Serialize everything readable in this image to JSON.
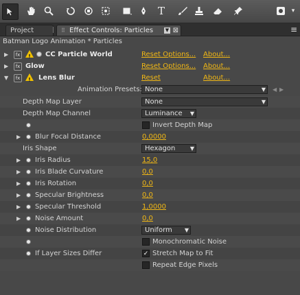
{
  "toolbar": {
    "tools": [
      "selection-tool",
      "hand-tool",
      "zoom-tool",
      "rotate-tool",
      "orbit-camera-tool",
      "pan-behind-tool",
      "rectangle-tool",
      "pen-tool",
      "text-tool",
      "brush-tool",
      "clone-stamp-tool",
      "eraser-tool",
      "puppet-pin-tool",
      "workspace-menu"
    ]
  },
  "tabs": {
    "project": "Project",
    "effect_controls": "Effect Controls: Particles"
  },
  "panel_header": "Batman Logo Animation * Particles",
  "effects": [
    {
      "name": "CC Particle World",
      "reset": "Reset Options...",
      "about": "About...",
      "warning": true,
      "expanded": false
    },
    {
      "name": "Glow",
      "reset": "Reset Options...",
      "about": "About...",
      "warning": false,
      "expanded": false
    },
    {
      "name": "Lens Blur",
      "reset": "Reset",
      "about": "About...",
      "warning": true,
      "expanded": true
    }
  ],
  "animation_presets": {
    "label": "Animation Presets:",
    "value": "None"
  },
  "properties": {
    "depth_map_layer": {
      "label": "Depth Map Layer",
      "value": "None"
    },
    "depth_map_channel": {
      "label": "Depth Map Channel",
      "value": "Luminance"
    },
    "invert_depth_map": {
      "label": "Invert Depth Map",
      "checked": false
    },
    "blur_focal_distance": {
      "label": "Blur Focal Distance",
      "value": "0,0000"
    },
    "iris_shape": {
      "label": "Iris Shape",
      "value": "Hexagon"
    },
    "iris_radius": {
      "label": "Iris Radius",
      "value": "15,0"
    },
    "iris_blade_curvature": {
      "label": "Iris Blade Curvature",
      "value": "0,0"
    },
    "iris_rotation": {
      "label": "Iris Rotation",
      "value": "0,0"
    },
    "specular_brightness": {
      "label": "Specular Brightness",
      "value": "0,0"
    },
    "specular_threshold": {
      "label": "Specular Threshold",
      "value": "1,0000"
    },
    "noise_amount": {
      "label": "Noise Amount",
      "value": "0,0"
    },
    "noise_distribution": {
      "label": "Noise Distribution",
      "value": "Uniform"
    },
    "monochromatic_noise": {
      "label": "Monochromatic Noise",
      "checked": false
    },
    "if_layer_sizes_differ": {
      "label": "If Layer Sizes Differ"
    },
    "stretch_map_to_fit": {
      "label": "Stretch Map to Fit",
      "checked": true
    },
    "repeat_edge_pixels": {
      "label": "Repeat Edge Pixels",
      "checked": false
    }
  },
  "colors": {
    "accent": "#f2b814",
    "panel_bg": "#484848",
    "warning": "#f0c000"
  }
}
